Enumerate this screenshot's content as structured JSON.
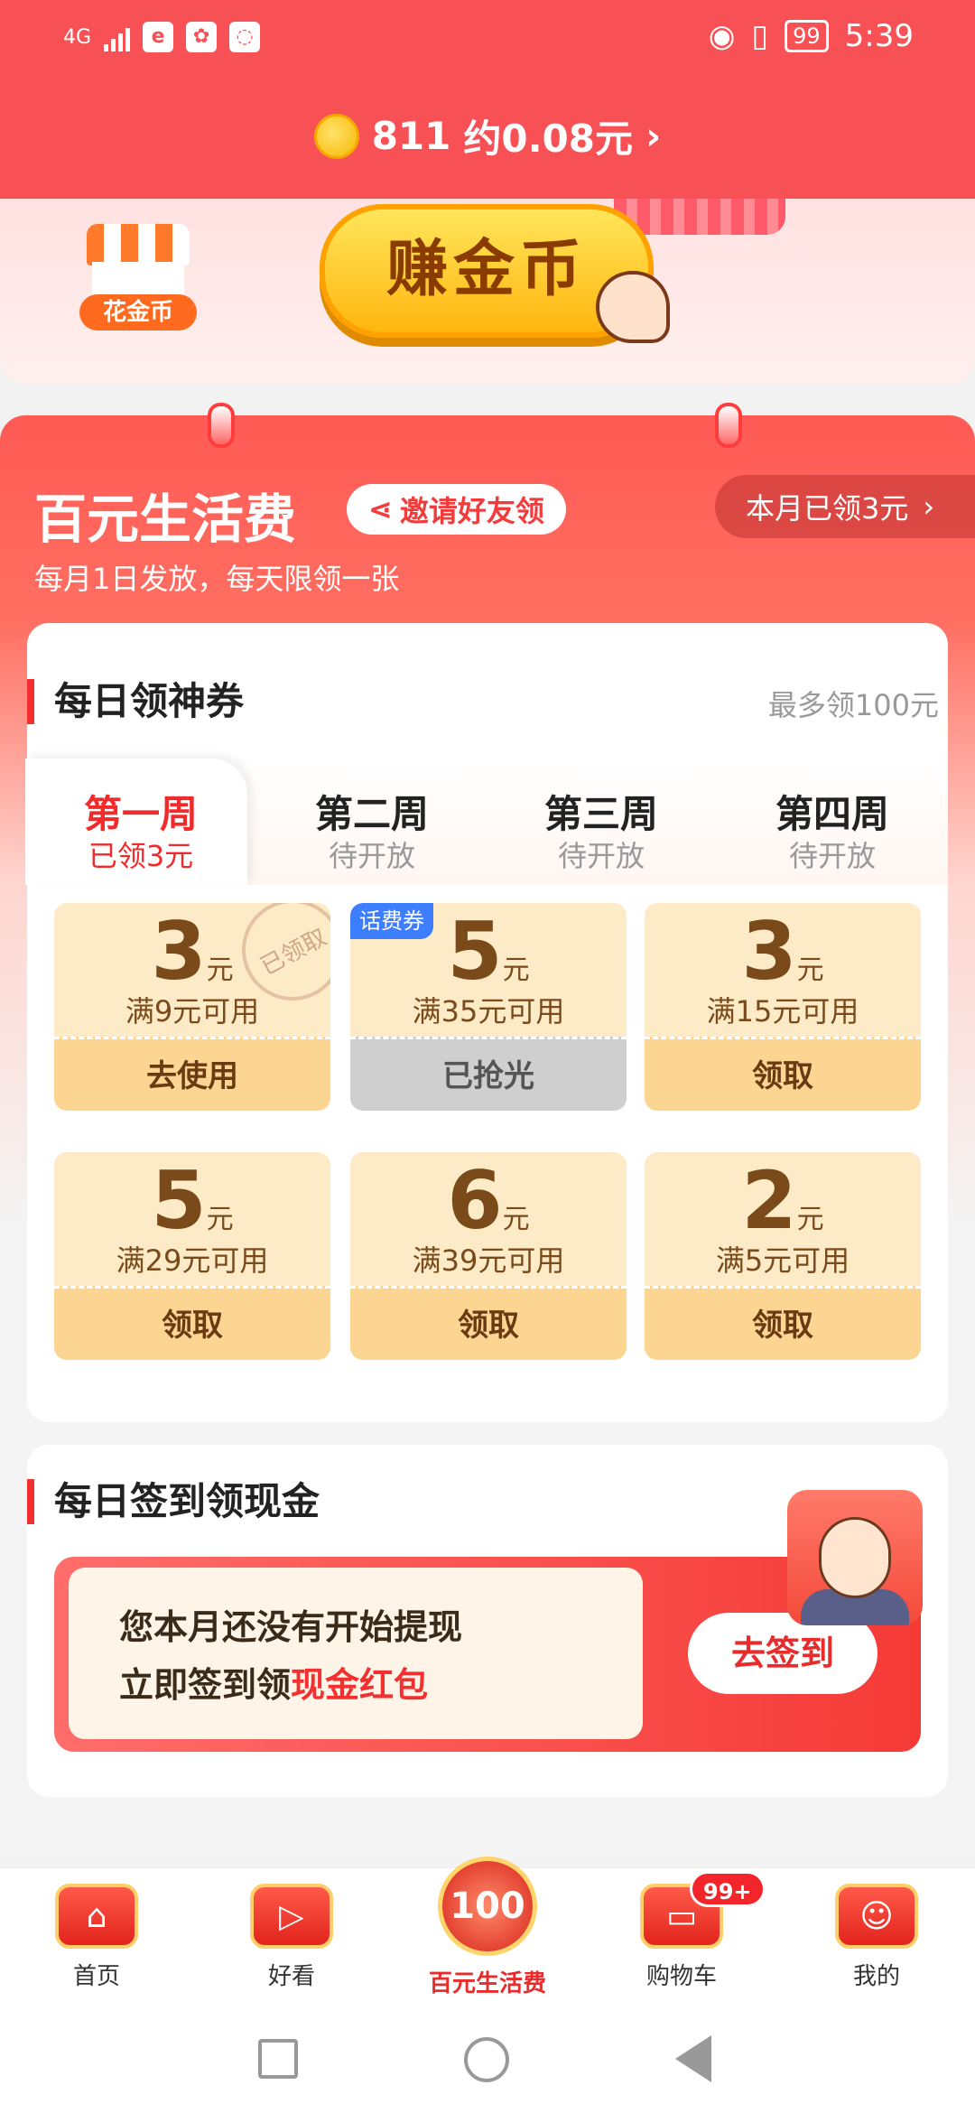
{
  "status_bar": {
    "network": "4G",
    "battery": "99",
    "time": "5:39"
  },
  "coins": {
    "amount": "811",
    "value": "约0.08元",
    "arrow": "›"
  },
  "banner": {
    "shop_label": "花金币",
    "earn_label": "赚金币"
  },
  "panel": {
    "title": "百元生活费",
    "invite_label": "邀请好友领",
    "month_received": "本月已领3元",
    "subtitle": "每月1日发放，每天限领一张"
  },
  "coupons_section": {
    "title": "每日领神券",
    "max_label": "最多领100元",
    "tabs": [
      {
        "week": "第一周",
        "status": "已领3元"
      },
      {
        "week": "第二周",
        "status": "待开放"
      },
      {
        "week": "第三周",
        "status": "待开放"
      },
      {
        "week": "第四周",
        "status": "待开放"
      }
    ],
    "coupons": [
      {
        "amount": "3",
        "unit": "元",
        "condition": "满9元可用",
        "button": "去使用",
        "stamp": "已领取"
      },
      {
        "amount": "5",
        "unit": "元",
        "condition": "满35元可用",
        "button": "已抢光",
        "tag": "话费券"
      },
      {
        "amount": "3",
        "unit": "元",
        "condition": "满15元可用",
        "button": "领取"
      },
      {
        "amount": "5",
        "unit": "元",
        "condition": "满29元可用",
        "button": "领取"
      },
      {
        "amount": "6",
        "unit": "元",
        "condition": "满39元可用",
        "button": "领取"
      },
      {
        "amount": "2",
        "unit": "元",
        "condition": "满5元可用",
        "button": "领取"
      }
    ]
  },
  "signin_section": {
    "title": "每日签到领现金",
    "line1": "您本月还没有开始提现",
    "line2_prefix": "立即签到领",
    "line2_highlight": "现金红包",
    "button": "去签到"
  },
  "bottom_nav": {
    "items": [
      {
        "label": "首页",
        "icon": "home-icon"
      },
      {
        "label": "好看",
        "icon": "play-icon"
      },
      {
        "label": "百元生活费",
        "icon": "100-icon"
      },
      {
        "label": "购物车",
        "icon": "cart-icon"
      },
      {
        "label": "我的",
        "icon": "face-icon"
      }
    ],
    "cart_badge": "99+",
    "center_icon_text": "100"
  },
  "colors": {
    "primary_red": "#f75055",
    "coupon_bg": "#fdebc8",
    "coupon_button": "#fcd592",
    "accent_red": "#f23030"
  }
}
